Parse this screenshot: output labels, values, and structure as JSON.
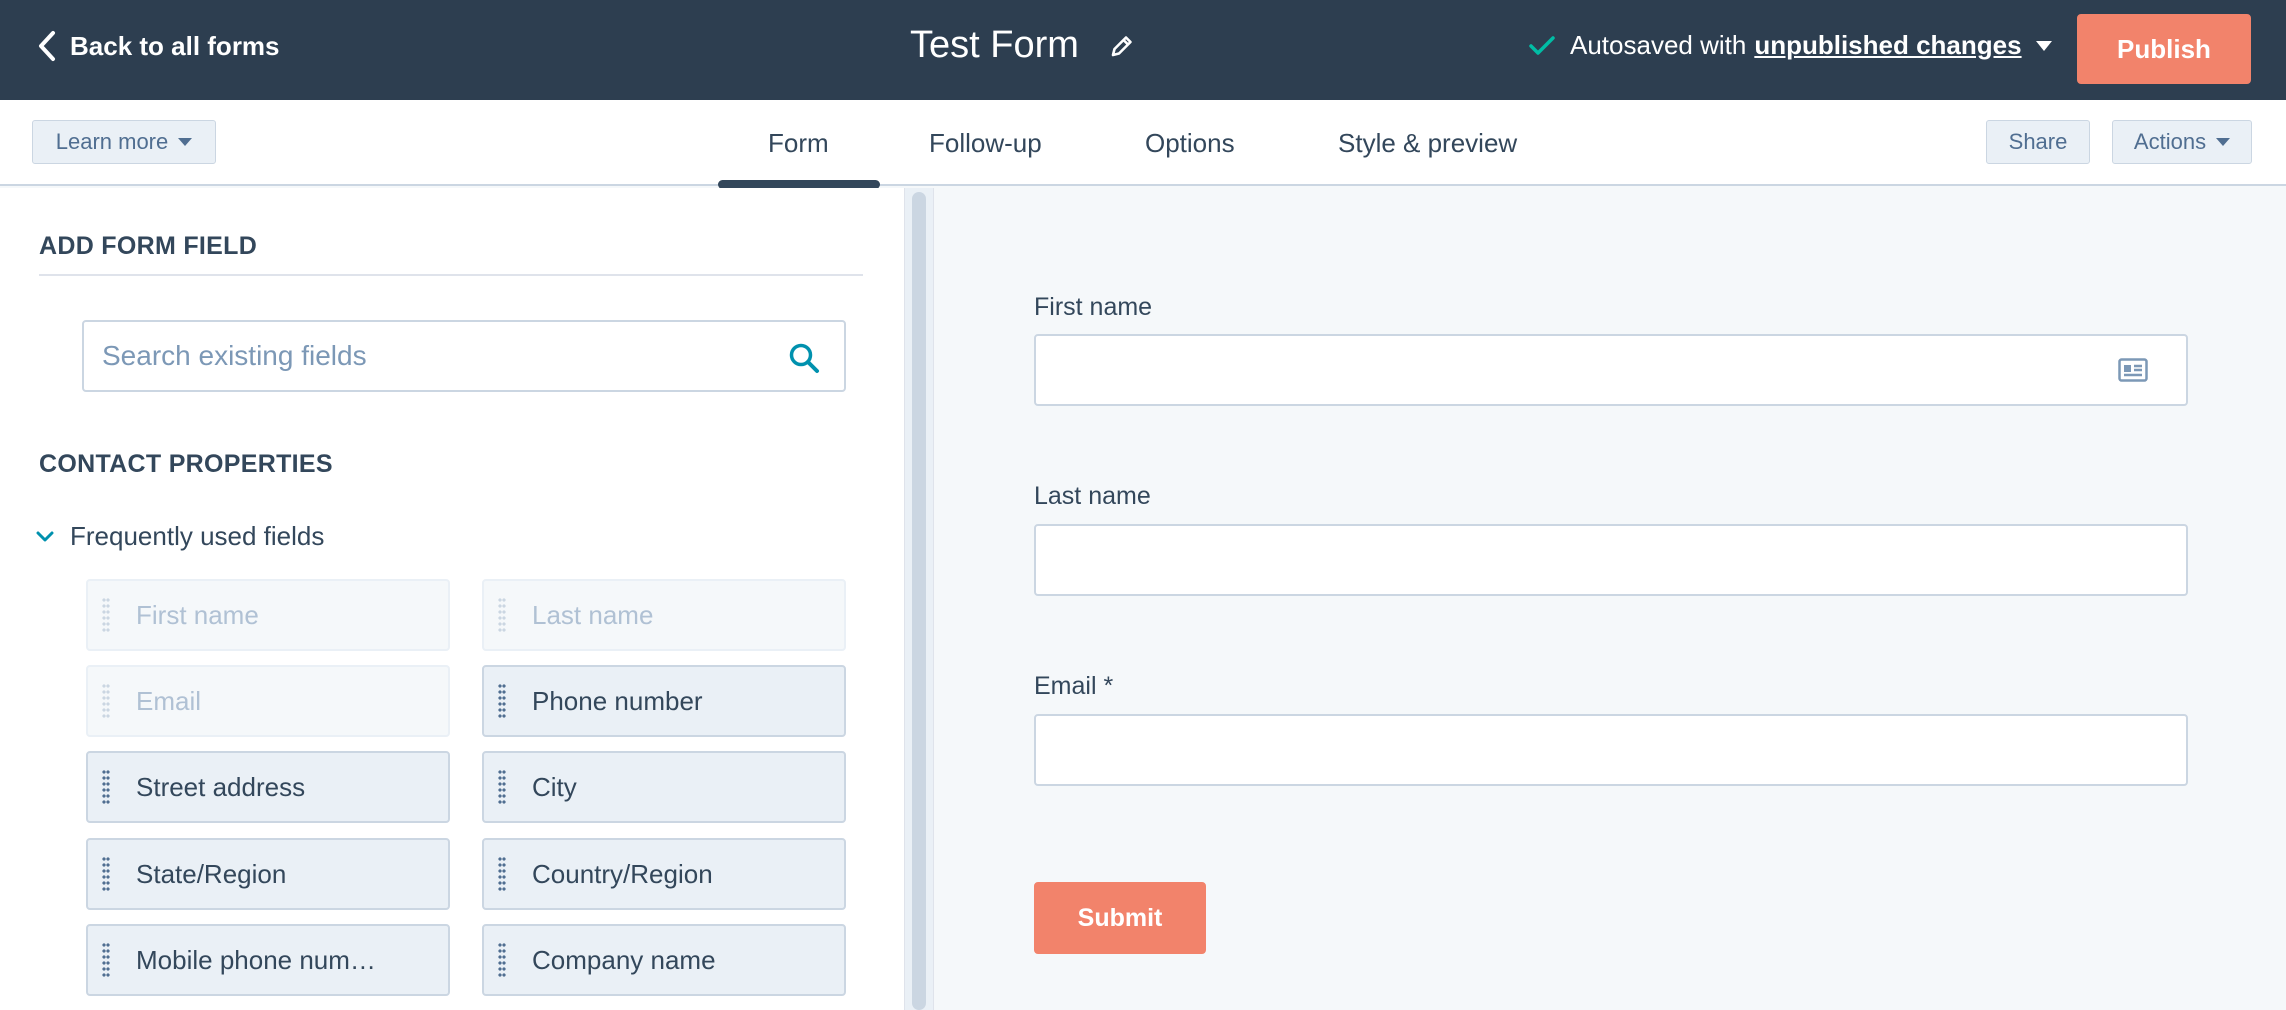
{
  "header": {
    "back_label": "Back to all forms",
    "form_title": "Test Form",
    "autosave_prefix": "Autosaved with",
    "autosave_link": "unpublished changes",
    "publish_label": "Publish"
  },
  "toolbar": {
    "learn_more_label": "Learn more",
    "share_label": "Share",
    "actions_label": "Actions",
    "tabs": [
      {
        "label": "Form",
        "active": true
      },
      {
        "label": "Follow-up",
        "active": false
      },
      {
        "label": "Options",
        "active": false
      },
      {
        "label": "Style & preview",
        "active": false
      }
    ]
  },
  "sidebar": {
    "add_field_title": "ADD FORM FIELD",
    "search_placeholder": "Search existing fields",
    "contact_properties_title": "CONTACT PROPERTIES",
    "group_label": "Frequently used fields",
    "fields": [
      {
        "label": "First name",
        "disabled": true
      },
      {
        "label": "Last name",
        "disabled": true
      },
      {
        "label": "Email",
        "disabled": true
      },
      {
        "label": "Phone number",
        "disabled": false
      },
      {
        "label": "Street address",
        "disabled": false
      },
      {
        "label": "City",
        "disabled": false
      },
      {
        "label": "State/Region",
        "disabled": false
      },
      {
        "label": "Country/Region",
        "disabled": false
      },
      {
        "label": "Mobile phone num…",
        "disabled": false
      },
      {
        "label": "Company name",
        "disabled": false
      }
    ]
  },
  "preview": {
    "fields": [
      {
        "label": "First name"
      },
      {
        "label": "Last name"
      },
      {
        "label": "Email *"
      }
    ],
    "submit_label": "Submit"
  },
  "colors": {
    "topbar": "#2d3e50",
    "accent": "#f2836b",
    "check": "#00bda5",
    "text": "#33475b"
  }
}
